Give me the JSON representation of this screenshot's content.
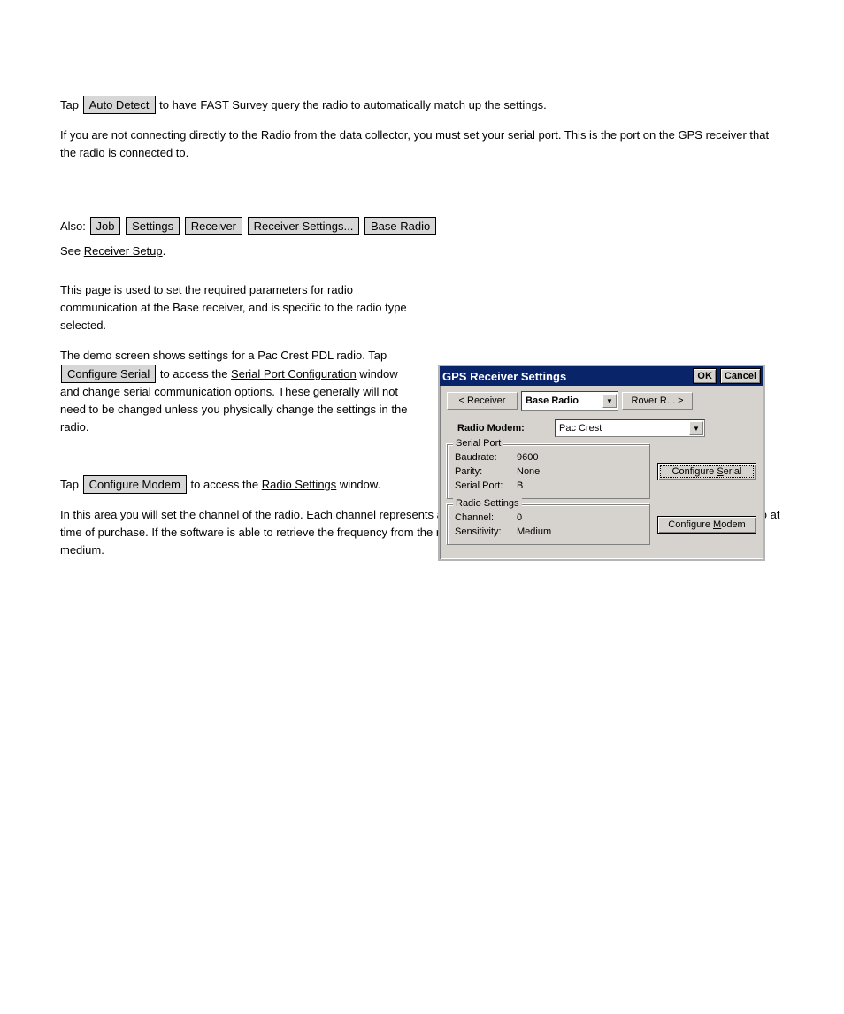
{
  "doc": {
    "p1_lead": "Tap ",
    "p1_btn": "Auto Detect",
    "p1_tail": " to have FAST Survey query the radio to automatically match up the settings.",
    "p2": "If you are not connecting directly to the Radio from the data collector, you must set your serial port. This is the port on the GPS receiver that the radio is connected to.",
    "breadcrumb": {
      "lead": "Also: ",
      "items": [
        "Job",
        "Settings",
        "Receiver",
        "Receiver Settings...",
        "Base Radio"
      ],
      "after_link_pre": "See ",
      "after_link": "Receiver Setup",
      "after_link_post": "."
    },
    "p3": "This page is used to set the required parameters for radio communication at the Base receiver, and is specific to the radio type selected.",
    "p4_lead": "The demo screen shows settings for a Pac Crest PDL radio. Tap ",
    "p4_btn": "Configure Serial",
    "p4_tail": " to access the ",
    "p4_link": "Serial Port Configuration",
    "p4_post": " window and change serial communication options. These generally will not need to be changed unless you physically change the settings in the radio.",
    "p5_lead": "Tap ",
    "p5_btn": "Configure Modem",
    "p5_tail": " to access the ",
    "p5_link": "Radio Settings",
    "p5_post": " window.",
    "p6a": "In this area you will set the channel of the radio. Each channel represents a different frequency; these should be documented with the radio at time of purchase. If the software is able to retrieve the frequency from the radio, it will be displayed.",
    "p6b": " Sensitivity should generally be kept at medium."
  },
  "dialog": {
    "title": "GPS Receiver Settings",
    "ok": "OK",
    "cancel": "Cancel",
    "nav_prev": "< Receiver",
    "nav_current": "Base Radio",
    "nav_next": "Rover R... >",
    "radio_modem_label": "Radio Modem:",
    "radio_modem_value": "Pac Crest",
    "serial_port": {
      "legend": "Serial Port",
      "baud_k": "Baudrate:",
      "baud_v": "9600",
      "parity_k": "Parity:",
      "parity_v": "None",
      "port_k": "Serial Port:",
      "port_v": "B"
    },
    "radio_settings": {
      "legend": "Radio Settings",
      "chan_k": "Channel:",
      "chan_v": "0",
      "sens_k": "Sensitivity:",
      "sens_v": "Medium"
    },
    "btn_cfg_serial_pre": "Configure ",
    "btn_cfg_serial_ul": "S",
    "btn_cfg_serial_post": "erial",
    "btn_cfg_modem_pre": "Configure ",
    "btn_cfg_modem_ul": "M",
    "btn_cfg_modem_post": "odem"
  }
}
